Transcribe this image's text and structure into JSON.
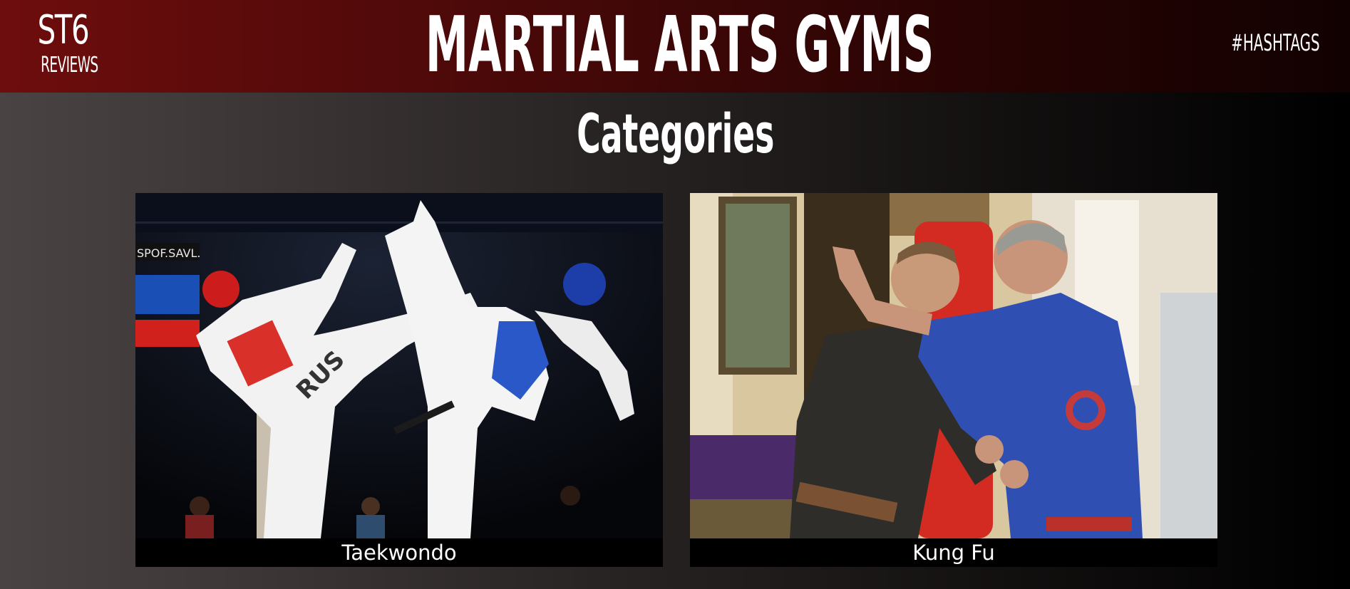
{
  "header": {
    "logo_main": "ST6",
    "logo_sub": "REVIEWS",
    "title": "MARTIAL ARTS GYMS",
    "hashtags_link": "#HASHTAGS"
  },
  "main": {
    "heading": "Categories",
    "categories": [
      {
        "label": "Taekwondo"
      },
      {
        "label": "Kung Fu"
      }
    ]
  },
  "photo_text": {
    "taekwondo_jersey": "RUS"
  },
  "colors": {
    "header_red": "#6e0d0d",
    "text": "#ffffff",
    "card_bg": "#000000"
  }
}
